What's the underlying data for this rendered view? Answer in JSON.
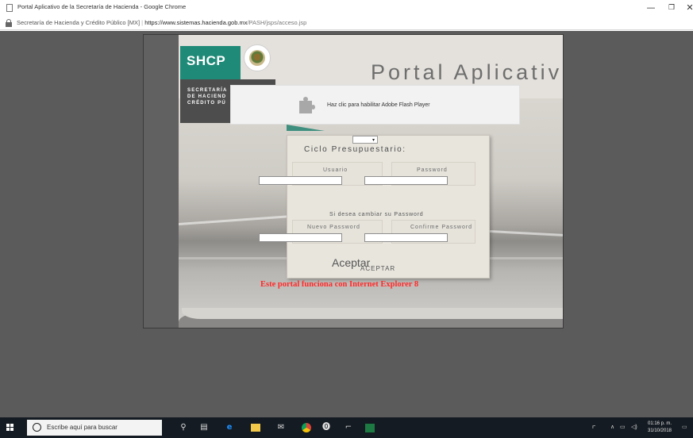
{
  "window": {
    "title": "Portal Aplicativo de la Secretaría de Hacienda - Google Chrome",
    "minimize_glyph": "—",
    "maximize_glyph": "❐",
    "close_glyph": "✕"
  },
  "addressbar": {
    "site_name": "Secretaría de Hacienda y Crédito Público [MX]",
    "separator": "|",
    "url_host": "https://www.sistemas.hacienda.gob.mx",
    "url_path": "/PASH/jsps/acceso.jsp"
  },
  "portal": {
    "brand": "SHCP",
    "secretaria_lines": [
      "SECRETARÍA",
      "DE HACIEND",
      "CRÉDITO PÚ"
    ],
    "title": "Portal Aplicativ",
    "flash_message": "Haz clic para habilitar Adobe Flash Player",
    "select_arrow": "▾",
    "ciclo_label": "Ciclo Presupuestario:",
    "usuario_label": "Usuario",
    "password_label": "Password",
    "usuario_value": "",
    "password_value": "",
    "change_note": "Si desea cambiar su Password",
    "nuevo_label": "Nuevo Password",
    "confirme_label": "Confirme Password",
    "nuevo_value": "",
    "confirme_value": "",
    "aceptar_large": "Aceptar",
    "aceptar_small": "ACEPTAR",
    "warning": "Este portal funciona con Internet Explorer 8",
    "warning_color": "#ff2a2a",
    "brand_color": "#1f8a78"
  },
  "taskbar": {
    "search_placeholder": "Escribe aquí para buscar",
    "time": "01:16 p. m.",
    "date": "31/10/2018",
    "icons": [
      "windows-start-icon",
      "microphone-icon",
      "task-view-icon",
      "edge-icon",
      "file-explorer-icon",
      "mail-icon",
      "chrome-icon",
      "tor-icon",
      "network-app-icon",
      "excel-icon"
    ]
  }
}
